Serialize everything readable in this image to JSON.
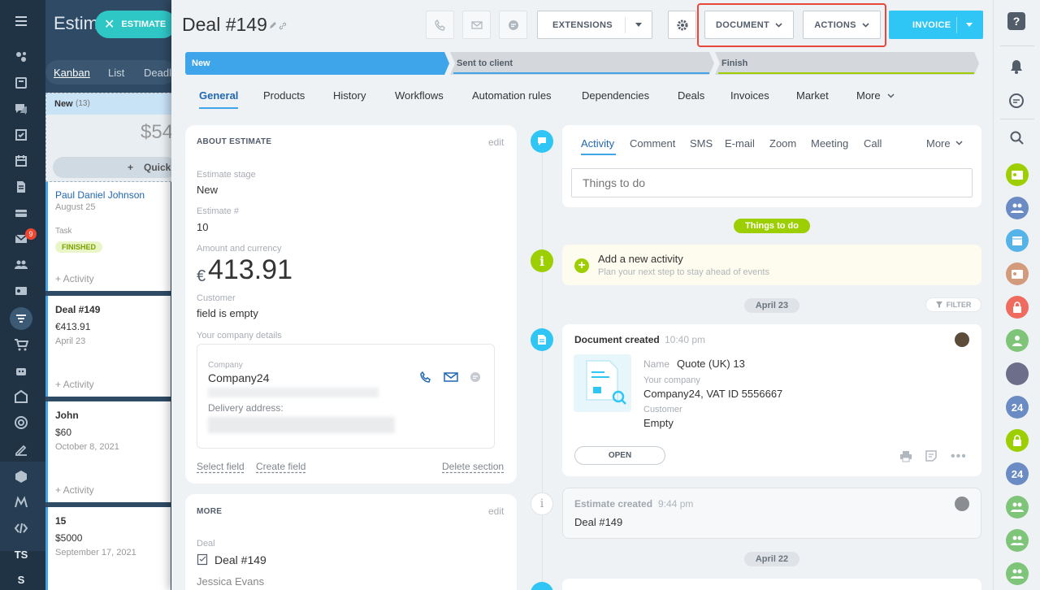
{
  "sidebar": {
    "mail_badge": "9",
    "bottom_labels": [
      "TS",
      "S"
    ]
  },
  "kanban": {
    "title": "Estim",
    "tabs": [
      "Kanban",
      "List",
      "Deadl"
    ],
    "column": {
      "name": "New",
      "count": "(13)",
      "sum": "$54",
      "quick_add": "Quick"
    },
    "cards": [
      {
        "name": "Paul Daniel Johnson",
        "date": "August 25",
        "task_label": "Task",
        "task_status": "FINISHED",
        "add": "+ Activity"
      },
      {
        "name": "Deal #149",
        "amount": "€413.91",
        "date": "April 23",
        "add": "+ Activity"
      },
      {
        "name": "John",
        "amount": "$60",
        "date": "October 8, 2021",
        "add": "+ Activity"
      },
      {
        "name": "15",
        "amount": "$5000",
        "date": "September 17, 2021"
      }
    ],
    "estimate_button": "ESTIMATE"
  },
  "header": {
    "title": "Deal #149",
    "extensions": "EXTENSIONS",
    "document": "DOCUMENT",
    "actions": "ACTIONS",
    "invoice": "INVOICE"
  },
  "stages": [
    {
      "label": "New",
      "color": "#3ea5ea"
    },
    {
      "label": "Sent to client",
      "color": "#d4d8dd"
    },
    {
      "label": "Finish",
      "color": "#d4d8dd"
    }
  ],
  "tabs": [
    "General",
    "Products",
    "History",
    "Workflows",
    "Automation rules",
    "Dependencies",
    "Deals",
    "Invoices",
    "Market",
    "More"
  ],
  "about": {
    "heading": "ABOUT ESTIMATE",
    "edit": "edit",
    "stage_label": "Estimate stage",
    "stage_value": "New",
    "number_label": "Estimate #",
    "number_value": "10",
    "amount_label": "Amount and currency",
    "amount_currency": "€",
    "amount_value": "413.91",
    "customer_label": "Customer",
    "customer_value": "field is empty",
    "company_details_label": "Your company details",
    "company_label": "Company",
    "company_value": "Company24",
    "delivery_label": "Delivery address:",
    "select_field": "Select field",
    "create_field": "Create field",
    "delete_section": "Delete section"
  },
  "more": {
    "heading": "MORE",
    "edit": "edit",
    "deal_label": "Deal",
    "deal_value": "Deal #149",
    "contact_value": "Jessica Evans"
  },
  "activity": {
    "tabs": [
      "Activity",
      "Comment",
      "SMS",
      "E-mail",
      "Zoom",
      "Meeting",
      "Call",
      "More"
    ],
    "placeholder": "Things to do",
    "things_to_do_pill": "Things to do",
    "add_title": "Add a new activity",
    "add_subtitle": "Plan your next step to stay ahead of events",
    "date1": "April 23",
    "filter": "FILTER",
    "doc_title": "Document created",
    "doc_time": "10:40 pm",
    "doc_name_label": "Name",
    "doc_name_value": "Quote (UK) 13",
    "doc_company_label": "Your company",
    "doc_company_value": "Company24, VAT ID 5556667",
    "doc_customer_label": "Customer",
    "doc_customer_value": "Empty",
    "open_button": "OPEN",
    "est_title": "Estimate created",
    "est_time": "9:44 pm",
    "est_value": "Deal #149",
    "date2": "April 22"
  },
  "rightbar": {
    "help": "?",
    "avatars_24": [
      "24",
      "24"
    ]
  },
  "colors": {
    "accent_blue": "#3ea5ea",
    "invoice_blue": "#2fc6f6",
    "green": "#9dcf00",
    "highlight_red": "#e8473b"
  }
}
